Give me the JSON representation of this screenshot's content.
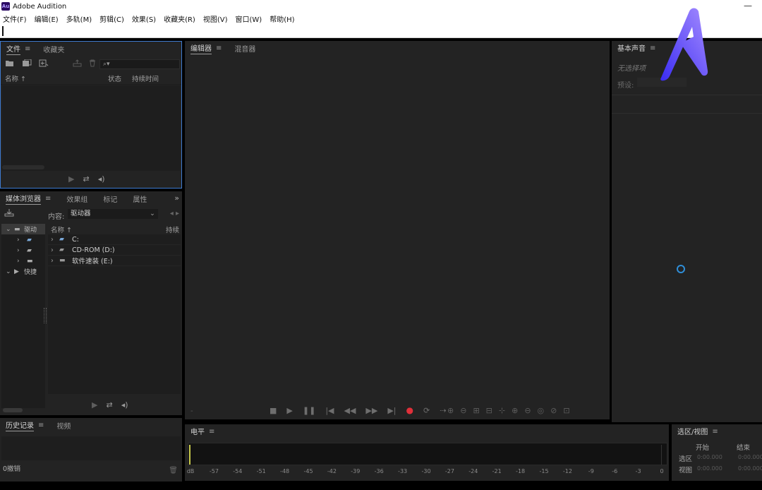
{
  "window": {
    "title": "Adobe Audition",
    "app_icon_text": "Au",
    "minimize_glyph": "—"
  },
  "menu": [
    "文件(F)",
    "编辑(E)",
    "多轨(M)",
    "剪辑(C)",
    "效果(S)",
    "收藏夹(R)",
    "视图(V)",
    "窗口(W)",
    "帮助(H)"
  ],
  "files_panel": {
    "tabs": [
      "文件",
      "收藏夹"
    ],
    "columns": {
      "name": "名称 ↑",
      "status": "状态",
      "duration": "持续时间"
    },
    "search_icon": "⌕▾",
    "controls": [
      "▶",
      "⇄",
      "◂)"
    ]
  },
  "media_panel": {
    "tabs": [
      "媒体浏览器",
      "效果组",
      "标记",
      "属性"
    ],
    "more": "»",
    "content_label": "内容:",
    "content_value": "驱动器",
    "nav": "◂ ▸",
    "tree": [
      "驱动",
      "",
      "",
      "",
      "快捷"
    ],
    "list_columns": {
      "name": "名称 ↑",
      "duration": "持续"
    },
    "list_rows": [
      "C:",
      "CD-ROM (D:)",
      "软件速装 (E:)"
    ],
    "controls": [
      "▶",
      "⇄",
      "◂)"
    ]
  },
  "history_panel": {
    "tabs": [
      "历史记录",
      "视频"
    ],
    "status": "0撤销",
    "trash": "🗑"
  },
  "editor_panel": {
    "tabs": [
      "编辑器",
      "混音器"
    ],
    "transport": [
      "■",
      "▶",
      "❚❚",
      "|◀",
      "◀◀",
      "▶▶",
      "▶|",
      "●",
      "⟳",
      "⇢"
    ],
    "zoom_tools": [
      "⊕",
      "⊖",
      "⊞",
      "⊟",
      "⊹",
      "⊕",
      "⊖",
      "◎",
      "⊘",
      "⊡"
    ],
    "dash": "-"
  },
  "essential_panel": {
    "tabs": [
      "基本声音"
    ],
    "empty_text": "无选择项",
    "preset_label": "预设:"
  },
  "meter_panel": {
    "tabs": [
      "电平"
    ],
    "scale": [
      "dB",
      "-57",
      "-54",
      "-51",
      "-48",
      "-45",
      "-42",
      "-39",
      "-36",
      "-33",
      "-30",
      "-27",
      "-24",
      "-21",
      "-18",
      "-15",
      "-12",
      "-9",
      "-6",
      "-3",
      "0"
    ]
  },
  "selview_panel": {
    "tabs": [
      "选区/视图"
    ],
    "col_start": "开始",
    "col_end": "结束",
    "row_selection": "选区",
    "row_view": "视图",
    "sel_start": "0:00.000",
    "sel_end": "0:00.000",
    "view_start": "0:00.000",
    "view_end": "0:00.000"
  },
  "colors": {
    "accent_blue": "#3e7bd0",
    "record_red": "#e0303a",
    "meter_yellow": "#c7c94a",
    "logo_start": "#3a2cf2",
    "logo_end": "#a58cff"
  }
}
